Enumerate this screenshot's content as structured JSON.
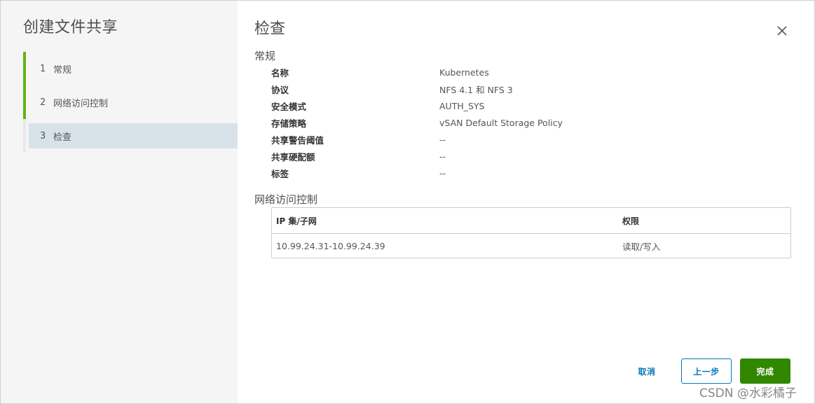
{
  "wizard": {
    "title": "创建文件共享",
    "steps": [
      {
        "num": "1",
        "label": "常规"
      },
      {
        "num": "2",
        "label": "网络访问控制"
      },
      {
        "num": "3",
        "label": "检查"
      }
    ]
  },
  "main": {
    "title": "检查",
    "general": {
      "section_title": "常规",
      "fields": [
        {
          "key": "名称",
          "value": "Kubernetes"
        },
        {
          "key": "协议",
          "value": "NFS 4.1 和 NFS 3"
        },
        {
          "key": "安全模式",
          "value": "AUTH_SYS"
        },
        {
          "key": "存储策略",
          "value": "vSAN Default Storage Policy"
        },
        {
          "key": "共享警告阈值",
          "value": "--"
        },
        {
          "key": "共享硬配额",
          "value": "--"
        },
        {
          "key": "标签",
          "value": "--"
        }
      ]
    },
    "network": {
      "section_title": "网络访问控制",
      "columns": [
        "IP 集/子网",
        "权限"
      ],
      "rows": [
        [
          "10.99.24.31-10.99.24.39",
          "读取/写入"
        ]
      ]
    }
  },
  "footer": {
    "cancel_label": "取消",
    "back_label": "上一步",
    "finish_label": "完成"
  },
  "watermark": "CSDN @水彩橘子",
  "colors": {
    "step_done": "#60b515",
    "step_current_bg": "#d8e3e9",
    "primary_green": "#318700",
    "link_blue": "#0079b8"
  },
  "icons": {
    "close": "close-icon"
  }
}
